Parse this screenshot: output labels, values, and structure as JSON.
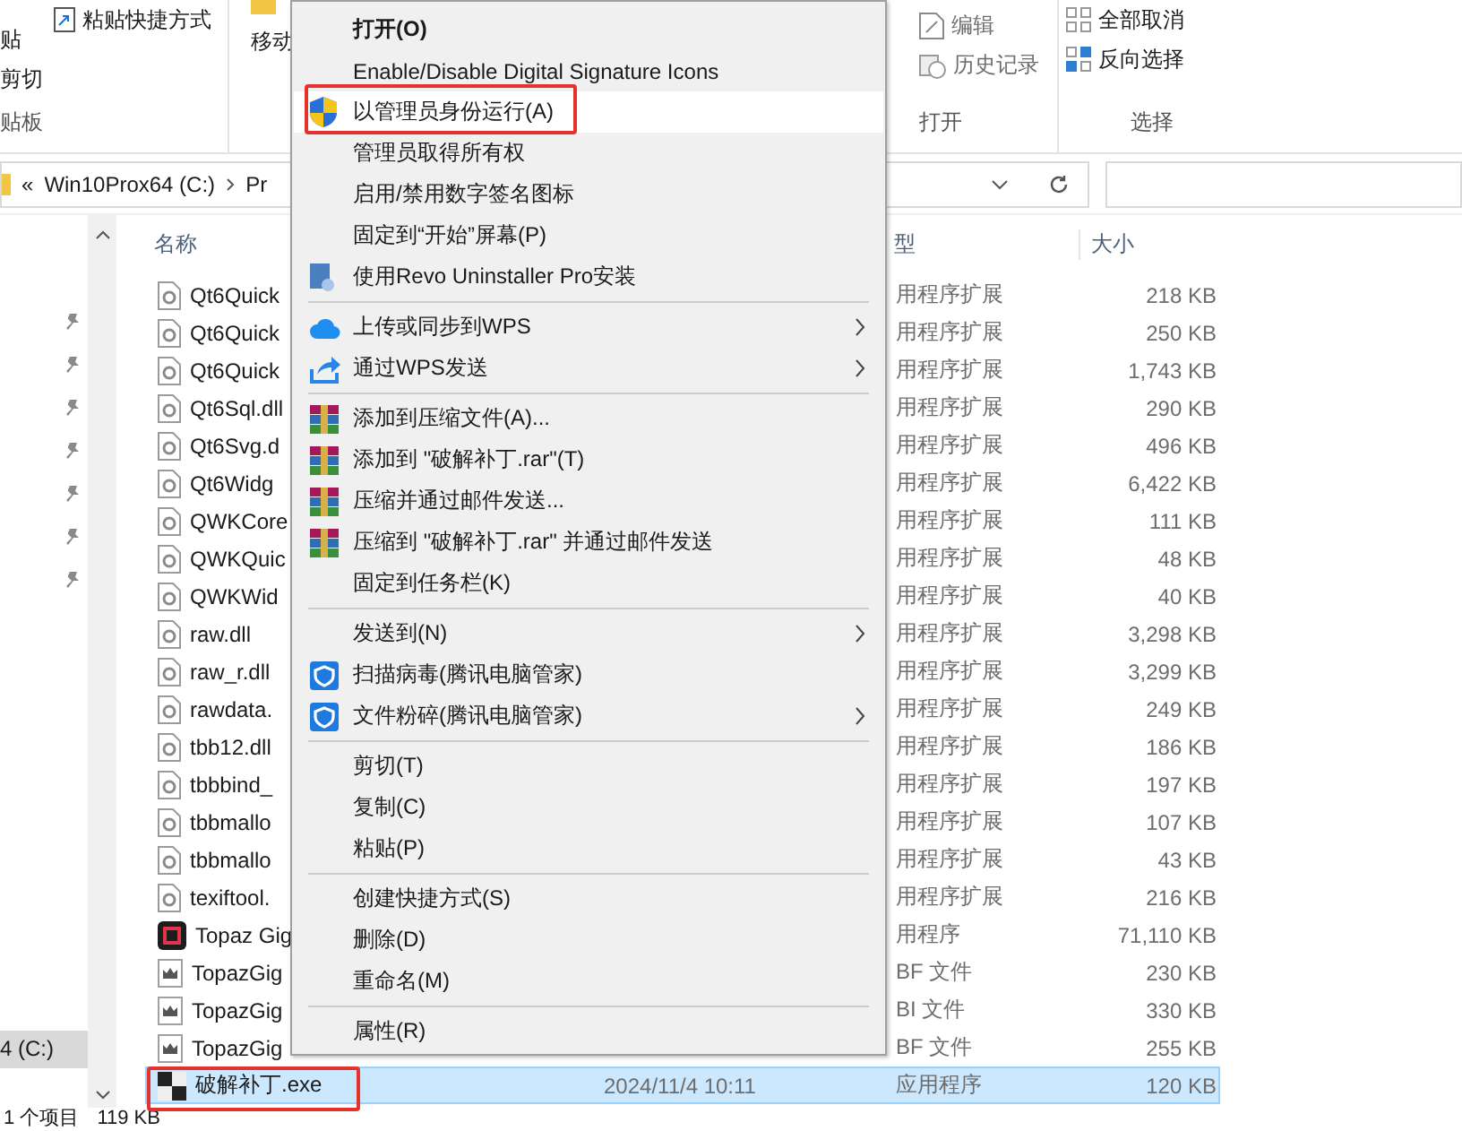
{
  "ribbon": {
    "clipboard": {
      "paste": "贴",
      "paste_shortcut": "粘贴快捷方式",
      "cut": "剪切",
      "group_label": "贴板"
    },
    "organize": {
      "move": "移动"
    },
    "open": {
      "edit": "编辑",
      "history": "历史记录",
      "group_label": "打开"
    },
    "select": {
      "select_none": "全部取消",
      "invert": "反向选择",
      "group_label": "选择"
    }
  },
  "address_bar": {
    "back_mark": "«",
    "segments": [
      "Win10Prox64 (C:)",
      "Pr"
    ]
  },
  "navigation": {
    "items": [
      {
        "label": "4 (C:)",
        "selected": true
      }
    ]
  },
  "file_list": {
    "columns": [
      "名称",
      "型",
      "大小"
    ],
    "rows": [
      {
        "kind": "library",
        "name": "Qt6Quick",
        "type": "用程序扩展",
        "size": "218 KB",
        "selected": false,
        "annotated": false
      },
      {
        "kind": "library",
        "name": "Qt6Quick",
        "type": "用程序扩展",
        "size": "250 KB",
        "selected": false,
        "annotated": false
      },
      {
        "kind": "library",
        "name": "Qt6Quick",
        "type": "用程序扩展",
        "size": "1,743 KB",
        "selected": false,
        "annotated": false
      },
      {
        "kind": "library",
        "name": "Qt6Sql.dll",
        "type": "用程序扩展",
        "size": "290 KB",
        "selected": false,
        "annotated": false
      },
      {
        "kind": "library",
        "name": "Qt6Svg.d",
        "type": "用程序扩展",
        "size": "496 KB",
        "selected": false,
        "annotated": false
      },
      {
        "kind": "library",
        "name": "Qt6Widg",
        "type": "用程序扩展",
        "size": "6,422 KB",
        "selected": false,
        "annotated": false
      },
      {
        "kind": "library",
        "name": "QWKCore",
        "type": "用程序扩展",
        "size": "111 KB",
        "selected": false,
        "annotated": false
      },
      {
        "kind": "library",
        "name": "QWKQuic",
        "type": "用程序扩展",
        "size": "48 KB",
        "selected": false,
        "annotated": false
      },
      {
        "kind": "library",
        "name": "QWKWid",
        "type": "用程序扩展",
        "size": "40 KB",
        "selected": false,
        "annotated": false
      },
      {
        "kind": "library",
        "name": "raw.dll",
        "type": "用程序扩展",
        "size": "3,298 KB",
        "selected": false,
        "annotated": false
      },
      {
        "kind": "library",
        "name": "raw_r.dll",
        "type": "用程序扩展",
        "size": "3,299 KB",
        "selected": false,
        "annotated": false
      },
      {
        "kind": "library",
        "name": "rawdata.",
        "type": "用程序扩展",
        "size": "249 KB",
        "selected": false,
        "annotated": false
      },
      {
        "kind": "library",
        "name": "tbb12.dll",
        "type": "用程序扩展",
        "size": "186 KB",
        "selected": false,
        "annotated": false
      },
      {
        "kind": "library",
        "name": "tbbbind_",
        "type": "用程序扩展",
        "size": "197 KB",
        "selected": false,
        "annotated": false
      },
      {
        "kind": "library",
        "name": "tbbmallo",
        "type": "用程序扩展",
        "size": "107 KB",
        "selected": false,
        "annotated": false
      },
      {
        "kind": "library",
        "name": "tbbmallo",
        "type": "用程序扩展",
        "size": "43 KB",
        "selected": false,
        "annotated": false
      },
      {
        "kind": "library",
        "name": "texiftool.",
        "type": "用程序扩展",
        "size": "216 KB",
        "selected": false,
        "annotated": false
      },
      {
        "kind": "application",
        "name": "Topaz Gig",
        "type": "用程序",
        "size": "71,110 KB",
        "selected": false,
        "annotated": false
      },
      {
        "kind": "data",
        "name": "TopazGig",
        "type": "BF 文件",
        "size": "230 KB",
        "selected": false,
        "annotated": false
      },
      {
        "kind": "data",
        "name": "TopazGig",
        "type": "BI 文件",
        "size": "330 KB",
        "selected": false,
        "annotated": false
      },
      {
        "kind": "data",
        "name": "TopazGig",
        "type": "BF 文件",
        "size": "255 KB",
        "selected": false,
        "annotated": false
      },
      {
        "kind": "executable",
        "name": "破解补丁.exe",
        "date": "2024/11/4 10:11",
        "type": "应用程序",
        "size": "120 KB",
        "selected": true,
        "annotated": true
      }
    ]
  },
  "context_menu": {
    "items": [
      {
        "kind": "plain",
        "label": "打开(O)",
        "bold": true,
        "highlighted": false,
        "annotated": false,
        "submenu": false
      },
      {
        "kind": "plain",
        "label": "Enable/Disable Digital Signature Icons",
        "bold": false,
        "highlighted": false,
        "annotated": false,
        "submenu": false
      },
      {
        "kind": "shield",
        "label": "以管理员身份运行(A)",
        "bold": false,
        "highlighted": true,
        "annotated": true,
        "submenu": false
      },
      {
        "kind": "plain",
        "label": "管理员取得所有权",
        "bold": false,
        "highlighted": false,
        "annotated": false,
        "submenu": false
      },
      {
        "kind": "plain",
        "label": "启用/禁用数字签名图标",
        "bold": false,
        "highlighted": false,
        "annotated": false,
        "submenu": false
      },
      {
        "kind": "plain",
        "label": "固定到“开始”屏幕(P)",
        "bold": false,
        "highlighted": false,
        "annotated": false,
        "submenu": false
      },
      {
        "kind": "installer",
        "label": "使用Revo Uninstaller Pro安装",
        "bold": false,
        "highlighted": false,
        "annotated": false,
        "submenu": false
      },
      {
        "kind": "separator"
      },
      {
        "kind": "cloud",
        "label": "上传或同步到WPS",
        "bold": false,
        "highlighted": false,
        "annotated": false,
        "submenu": true
      },
      {
        "kind": "share",
        "label": "通过WPS发送",
        "bold": false,
        "highlighted": false,
        "annotated": false,
        "submenu": true
      },
      {
        "kind": "separator"
      },
      {
        "kind": "archive",
        "label": "添加到压缩文件(A)...",
        "bold": false,
        "highlighted": false,
        "annotated": false,
        "submenu": false
      },
      {
        "kind": "archive",
        "label": "添加到 \"破解补丁.rar\"(T)",
        "bold": false,
        "highlighted": false,
        "annotated": false,
        "submenu": false
      },
      {
        "kind": "archive",
        "label": "压缩并通过邮件发送...",
        "bold": false,
        "highlighted": false,
        "annotated": false,
        "submenu": false
      },
      {
        "kind": "archive",
        "label": "压缩到 \"破解补丁.rar\" 并通过邮件发送",
        "bold": false,
        "highlighted": false,
        "annotated": false,
        "submenu": false
      },
      {
        "kind": "plain",
        "label": "固定到任务栏(K)",
        "bold": false,
        "highlighted": false,
        "annotated": false,
        "submenu": false
      },
      {
        "kind": "separator"
      },
      {
        "kind": "plain",
        "label": "发送到(N)",
        "bold": false,
        "highlighted": false,
        "annotated": false,
        "submenu": true
      },
      {
        "kind": "guard",
        "label": "扫描病毒(腾讯电脑管家)",
        "bold": false,
        "highlighted": false,
        "annotated": false,
        "submenu": false
      },
      {
        "kind": "guard",
        "label": "文件粉碎(腾讯电脑管家)",
        "bold": false,
        "highlighted": false,
        "annotated": false,
        "submenu": true
      },
      {
        "kind": "separator"
      },
      {
        "kind": "plain",
        "label": "剪切(T)",
        "bold": false,
        "highlighted": false,
        "annotated": false,
        "submenu": false
      },
      {
        "kind": "plain",
        "label": "复制(C)",
        "bold": false,
        "highlighted": false,
        "annotated": false,
        "submenu": false
      },
      {
        "kind": "plain",
        "label": "粘贴(P)",
        "bold": false,
        "highlighted": false,
        "annotated": false,
        "submenu": false
      },
      {
        "kind": "separator"
      },
      {
        "kind": "plain",
        "label": "创建快捷方式(S)",
        "bold": false,
        "highlighted": false,
        "annotated": false,
        "submenu": false
      },
      {
        "kind": "plain",
        "label": "删除(D)",
        "bold": false,
        "highlighted": false,
        "annotated": false,
        "submenu": false
      },
      {
        "kind": "plain",
        "label": "重命名(M)",
        "bold": false,
        "highlighted": false,
        "annotated": false,
        "submenu": false
      },
      {
        "kind": "separator"
      },
      {
        "kind": "plain",
        "label": "属性(R)",
        "bold": false,
        "highlighted": false,
        "annotated": false,
        "submenu": false
      }
    ]
  },
  "status_bar": {
    "count": "1 个项目",
    "size": "119 KB"
  }
}
